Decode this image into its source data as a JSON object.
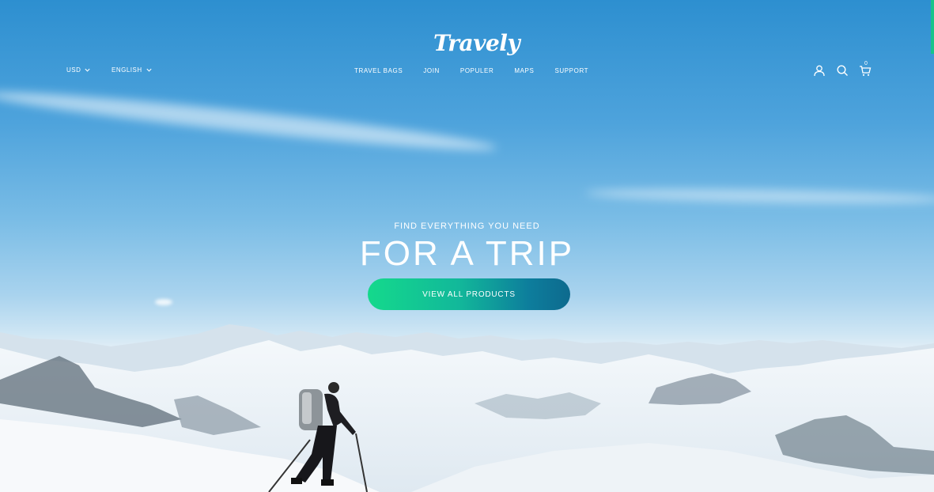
{
  "brand": {
    "logo_text": "Travely"
  },
  "topbar": {
    "currency": {
      "label": "USD"
    },
    "language": {
      "label": "ENGLISH"
    }
  },
  "nav": {
    "items": [
      {
        "label": "TRAVEL BAGS"
      },
      {
        "label": "JOIN"
      },
      {
        "label": "POPULER"
      },
      {
        "label": "MAPS"
      },
      {
        "label": "SUPPORT"
      }
    ]
  },
  "header_icons": {
    "account": "user-icon",
    "search": "search-icon",
    "cart": "cart-icon",
    "cart_count": "0"
  },
  "hero": {
    "subtitle": "FIND EVERYTHING YOU NEED",
    "title": "FOR A TRIP",
    "cta_label": "VIEW ALL PRODUCTS"
  },
  "colors": {
    "cta_gradient_start": "#14d98c",
    "cta_gradient_end": "#0d6a8e",
    "accent": "#18c48a"
  }
}
